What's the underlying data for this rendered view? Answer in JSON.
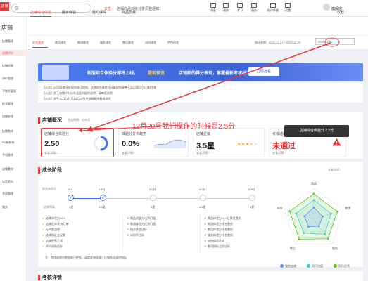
{
  "header": {
    "logo": "店铺",
    "notice_tag": "公告",
    "notice_text": "店铺商品三级分类调整通知",
    "icons": [
      {
        "name": "message-icon",
        "label": "消息"
      },
      {
        "name": "rule-icon",
        "label": "规则"
      },
      {
        "name": "school-icon",
        "label": "学习"
      },
      {
        "name": "service-icon",
        "label": "服务"
      },
      {
        "name": "account-icon",
        "label": "账户余额"
      },
      {
        "name": "settings-icon",
        "label": "设置"
      }
    ],
    "username": "旗舰店"
  },
  "sidebar": {
    "title": "店铺",
    "items": [
      {
        "label": "店铺管理",
        "active": false
      },
      {
        "label": "店铺评分",
        "active": true
      },
      {
        "label": "店铺经营",
        "active": false
      },
      {
        "label": "评价管理",
        "active": false
      },
      {
        "label": "子账号管理",
        "active": false
      },
      {
        "label": "账号管理",
        "active": false
      },
      {
        "label": "违规处理",
        "active": false
      },
      {
        "label": "店铺装修",
        "active": false
      },
      {
        "label": "PC端装修",
        "active": false
      },
      {
        "label": "手机装修",
        "active": false
      },
      {
        "label": "店铺素材",
        "active": false
      },
      {
        "label": "认证资料",
        "active": false
      },
      {
        "label": "合同管理",
        "active": false
      },
      {
        "label": "服务",
        "active": false
      }
    ]
  },
  "subnav": {
    "tabs": [
      "店铺综合体验",
      "服务体验",
      "履约保障",
      "商品质量"
    ],
    "fold": "收起"
  },
  "content_tabs": {
    "tabs": [
      "综合体验",
      "商品体验",
      "物流体验",
      "服务体验",
      "售后体验",
      "纠纷体验",
      "特色体验"
    ],
    "stat_time": "统计周期：2023-11-21 ~ 2023-12-20",
    "date_value": "2023-12-20"
  },
  "banner": {
    "text1": "新版综合体验分即将上线，",
    "text2": "提前预览",
    "text3": "店铺新的得分表现，掌握最新考核标准！",
    "button": "立即查看"
  },
  "announcements": [
    "【公告】2023年度评价规则修订通知，店铺综合体验分计算规则调整于2024年1月1日起生效",
    "【公告】关于店铺评分体系全面升级的说明，请商家知悉",
    "【公告】关于11月21日至12月20日考核周期的数据说明"
  ],
  "overview": {
    "title": "店铺概况",
    "subtitle": "考核周期：近30天",
    "cards": [
      {
        "label": "店铺综合体验分",
        "value": "2.50",
        "link": "查看详情 ›"
      },
      {
        "label": "体验分分布趋势",
        "value": "0.0%",
        "link": "查看详情 ›"
      },
      {
        "label": "店铺星级",
        "value": "3.5星",
        "link": "查看详情 ›"
      },
      {
        "label": "考核通过状态",
        "value": "未通过",
        "link": "查看详情 ›"
      }
    ],
    "score_ring_fraction": 0.5,
    "stars": 3.5,
    "tooltip": "店铺综合体验分 2.5分"
  },
  "annotation": {
    "text": "12月20号我们操作的时候是2.5分",
    "color": "#e4393c"
  },
  "growth": {
    "title": "成长阶段",
    "more": "查看详情 ›",
    "level_label": "综合体验分",
    "stage_label": "店铺等级",
    "stages": [
      {
        "value": "0.0",
        "name": "1星",
        "done": true
      },
      {
        "value": "2.4分",
        "name": "3.5星",
        "done": true
      },
      {
        "value": "3.0分",
        "name": "4星",
        "done": false
      },
      {
        "value": "4.0分",
        "name": "4.5星",
        "done": false
      },
      {
        "value": "4.5分",
        "name": "5星",
        "done": false
      }
    ],
    "req_col1": [
      {
        "mark": "✓",
        "text": "店铺体验分≥2.0"
      },
      {
        "mark": "✓",
        "text": "店铺近30天有订单"
      },
      {
        "mark": "✓",
        "text": "无严重违规"
      },
      {
        "mark": "✓",
        "text": "店铺保证金足额"
      },
      {
        "mark": "✓",
        "text": "店铺经营正常"
      },
      {
        "mark": "✓",
        "text": "评价成绩达标"
      }
    ],
    "req_col2": [
      {
        "mark": "✕",
        "text": "商品质量分达到门槛"
      },
      {
        "mark": "✕",
        "text": "物流体验分达到门槛"
      },
      {
        "mark": "✕",
        "text": "服务体验达标"
      },
      {
        "mark": "✕",
        "text": "纠纷率达标"
      }
    ],
    "req_col3": [
      {
        "mark": "✕",
        "text": "商品体验分≥4.0且排名靠前"
      },
      {
        "mark": "✕",
        "text": "物流体验分排名靠前"
      },
      {
        "mark": "✕",
        "text": "售后体验分排名靠前"
      },
      {
        "mark": "✕",
        "text": "服务体验分排名靠前"
      },
      {
        "mark": "✕",
        "text": "纠纷体验达标"
      },
      {
        "mark": "✕",
        "text": "各项指标全部达标"
      }
    ],
    "footnote": "注：考核周期内数据每日更新，请商家持续关注店铺各项体验指标"
  },
  "chart_data": {
    "type": "radar",
    "axes": [
      "商品",
      "物流",
      "服务",
      "售后",
      "纠纷"
    ],
    "series": [
      {
        "name": "我的店铺",
        "color": "#5b8ff9",
        "values": [
          0.38,
          0.3,
          0.28,
          0.3,
          0.32
        ]
      },
      {
        "name": "同行均值",
        "color": "#36cfc9",
        "values": [
          0.62,
          0.58,
          0.6,
          0.55,
          0.6
        ]
      },
      {
        "name": "同行优秀",
        "color": "#52c41a",
        "values": [
          0.82,
          0.8,
          0.78,
          0.8,
          0.82
        ]
      }
    ]
  },
  "exam": {
    "title": "考核详情"
  }
}
